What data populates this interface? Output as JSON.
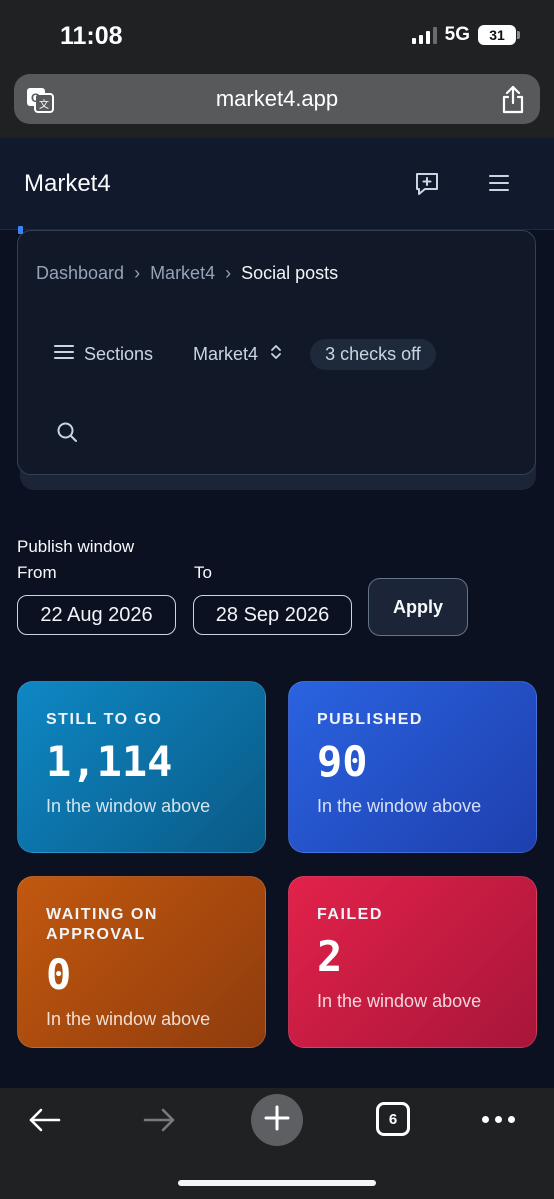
{
  "status_bar": {
    "time": "11:08",
    "network": "5G",
    "battery": "31"
  },
  "browser": {
    "url": "market4.app",
    "tab_count": "6"
  },
  "header": {
    "title": "Market4"
  },
  "breadcrumb": {
    "items": [
      "Dashboard",
      "Market4",
      "Social posts"
    ]
  },
  "toolbar": {
    "sections_label": "Sections",
    "project_label": "Market4",
    "checks_badge": "3 checks off"
  },
  "filter": {
    "heading": "Publish window",
    "from_label": "From",
    "to_label": "To",
    "from_value": "22 Aug 2026",
    "to_value": "28 Sep 2026",
    "apply_label": "Apply"
  },
  "stats": [
    {
      "label": "STILL TO GO",
      "value": "1,114",
      "caption": "In the window above",
      "color": "#0e87c4"
    },
    {
      "label": "PUBLISHED",
      "value": "90",
      "caption": "In the window above",
      "color": "#2a63e0"
    },
    {
      "label": "WAITING ON APPROVAL",
      "value": "0",
      "caption": "In the window above",
      "color": "#c2580f"
    },
    {
      "label": "FAILED",
      "value": "2",
      "caption": "In the window above",
      "color": "#e2224a"
    }
  ],
  "icons": [
    "translate-icon",
    "share-icon",
    "feedback-icon",
    "menu-icon",
    "hamburger-icon",
    "chevron-updown-icon",
    "search-icon",
    "back-arrow-icon",
    "forward-arrow-icon",
    "plus-icon",
    "more-icon"
  ]
}
